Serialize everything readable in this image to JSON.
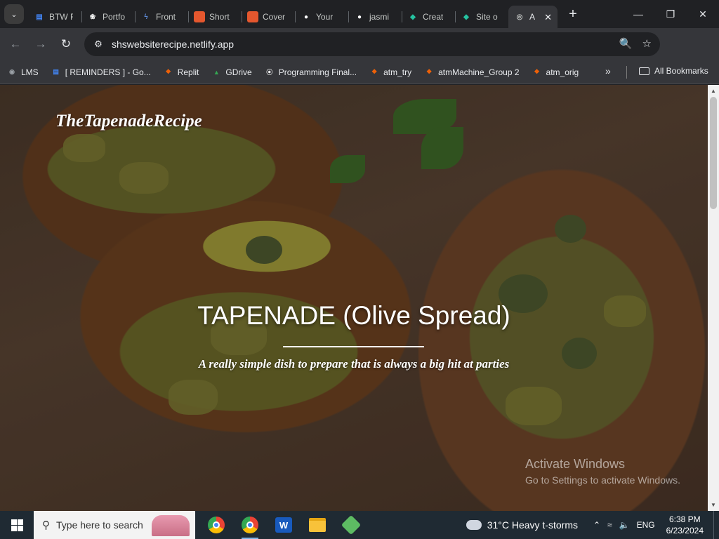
{
  "browser": {
    "tabs": [
      {
        "label": "BTW F",
        "icon": "google-docs-icon",
        "color": "#4285f4"
      },
      {
        "label": "Portfo",
        "icon": "openai-icon",
        "color": "#ffffff"
      },
      {
        "label": "Front",
        "icon": "lightning-icon",
        "color": "#5d8ad6"
      },
      {
        "label": "Short",
        "icon": "gamma-icon",
        "color": "#e4572e"
      },
      {
        "label": "Cover",
        "icon": "gamma-icon",
        "color": "#e4572e"
      },
      {
        "label": "Your",
        "icon": "github-icon",
        "color": "#ffffff"
      },
      {
        "label": "jasmi",
        "icon": "github-icon",
        "color": "#ffffff"
      },
      {
        "label": "Creat",
        "icon": "netlify-icon",
        "color": "#25c2a0"
      },
      {
        "label": "Site o",
        "icon": "netlify-icon",
        "color": "#25c2a0"
      },
      {
        "label": "A",
        "icon": "globe-icon",
        "color": "#c4c7c5",
        "active": true
      }
    ],
    "url": "shswebsiterecipe.netlify.app",
    "bookmarks": [
      {
        "label": "LMS",
        "icon": "lms-icon",
        "color": "#9aa0a6"
      },
      {
        "label": "[ REMINDERS ] - Go...",
        "icon": "google-docs-icon",
        "color": "#4285f4"
      },
      {
        "label": "Replit",
        "icon": "replit-icon",
        "color": "#f26207"
      },
      {
        "label": "GDrive",
        "icon": "drive-icon",
        "color": "#34a853"
      },
      {
        "label": "Programming Final...",
        "icon": "colab-icon",
        "color": "#ffffff"
      },
      {
        "label": "atm_try",
        "icon": "replit-icon",
        "color": "#f26207"
      },
      {
        "label": "atmMachine_Group 2",
        "icon": "replit-icon",
        "color": "#f26207"
      },
      {
        "label": "atm_orig",
        "icon": "replit-icon",
        "color": "#f26207"
      }
    ],
    "all_bookmarks": "All Bookmarks"
  },
  "page": {
    "brand": "TheTapenadeRecipe",
    "hero_title": "TAPENADE (Olive Spread)",
    "hero_subtitle": "A really simple dish to prepare that is always a big hit at parties"
  },
  "watermark": {
    "line1": "Activate Windows",
    "line2": "Go to Settings to activate Windows."
  },
  "taskbar": {
    "search_placeholder": "Type here to search",
    "weather": "31°C  Heavy t-storms",
    "language": "ENG",
    "time": "6:38 PM",
    "date": "6/23/2024"
  }
}
